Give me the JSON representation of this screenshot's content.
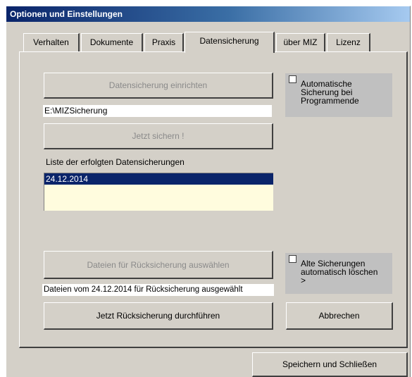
{
  "window": {
    "title": "Optionen und Einstellungen"
  },
  "tabs": [
    {
      "label": "Verhalten"
    },
    {
      "label": "Dokumente"
    },
    {
      "label": "Praxis"
    },
    {
      "label": "Datensicherung",
      "active": true
    },
    {
      "label": "über MIZ"
    },
    {
      "label": "Lizenz"
    }
  ],
  "backup": {
    "setup_button": "Datensicherung einrichten",
    "path_value": "E:\\MIZSicherung",
    "backup_now_button": "Jetzt sichern !",
    "auto_backup_checkbox": "Automatische Sicherung bei Programmende",
    "auto_backup_checked": false
  },
  "history": {
    "label": "Liste der erfolgten Datensicherungen",
    "items": [
      "24.12.2014"
    ],
    "selected_index": 0
  },
  "restore": {
    "select_files_button": "Dateien für Rücksicherung  auswählen",
    "status_text": "Dateien vom 24.12.2014 für Rücksicherung ausgewählt",
    "perform_button": "Jetzt Rücksicherung durchführen",
    "delete_old_checkbox": "Alte Sicherungen automatisch löschen  >",
    "delete_old_checked": false
  },
  "footer": {
    "cancel_button": "Abbrechen",
    "save_close_button": "Speichern und Schließen"
  }
}
